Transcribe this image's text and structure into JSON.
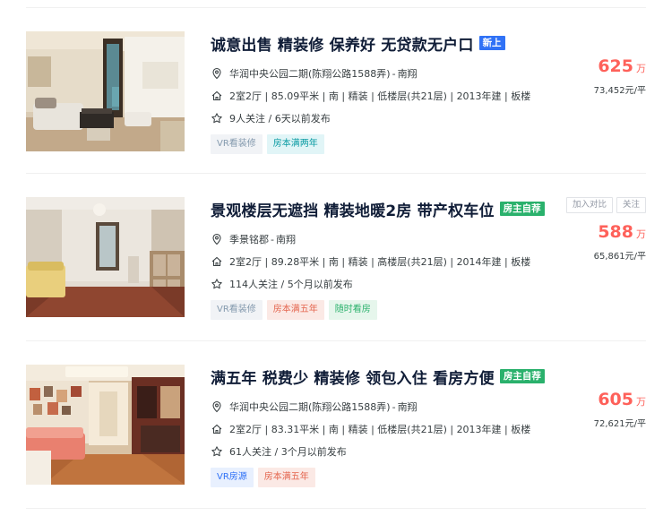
{
  "listings": [
    {
      "title": "诚意出售 精装修 保养好 无贷款无户口",
      "badge": "新上",
      "community": "华润中央公园二期(陈翔公路1588弄)",
      "district": "南翔",
      "house_info": "2室2厅 | 85.09平米 | 南 | 精装 | 低楼层(共21层) | 2013年建 | 板楼",
      "follow_info": "9人关注 / 6天以前发布",
      "tags": [
        "VR看装修",
        "房本满两年"
      ],
      "price": "625",
      "price_unit": "万",
      "unit_price": "73,452元/平"
    },
    {
      "title": "景观楼层无遮挡 精装地暖2房 带产权车位",
      "badge": "房主自荐",
      "community": "季景铭郡",
      "district": "南翔",
      "house_info": "2室2厅 | 89.28平米 | 南 | 精装 | 高楼层(共21层) | 2014年建 | 板楼",
      "follow_info": "114人关注 / 5个月以前发布",
      "tags": [
        "VR看装修",
        "房本满五年",
        "随时看房"
      ],
      "price": "588",
      "price_unit": "万",
      "unit_price": "65,861元/平",
      "actions": [
        "加入对比",
        "关注"
      ]
    },
    {
      "title": "满五年 税费少 精装修 领包入住 看房方便",
      "badge": "房主自荐",
      "community": "华润中央公园二期(陈翔公路1588弄)",
      "district": "南翔",
      "house_info": "2室2厅 | 83.31平米 | 南 | 精装 | 低楼层(共21层) | 2013年建 | 板楼",
      "follow_info": "61人关注 / 3个月以前发布",
      "tags": [
        "VR房源",
        "房本满五年"
      ],
      "price": "605",
      "price_unit": "万",
      "unit_price": "72,621元/平"
    }
  ],
  "separator": "-",
  "colors": {
    "price": "#fe615a",
    "new_badge": "#3072f6",
    "owner_badge": "#2ab16c"
  },
  "icons": {
    "location": "location-pin-icon",
    "house": "house-icon",
    "follow": "star-icon"
  }
}
